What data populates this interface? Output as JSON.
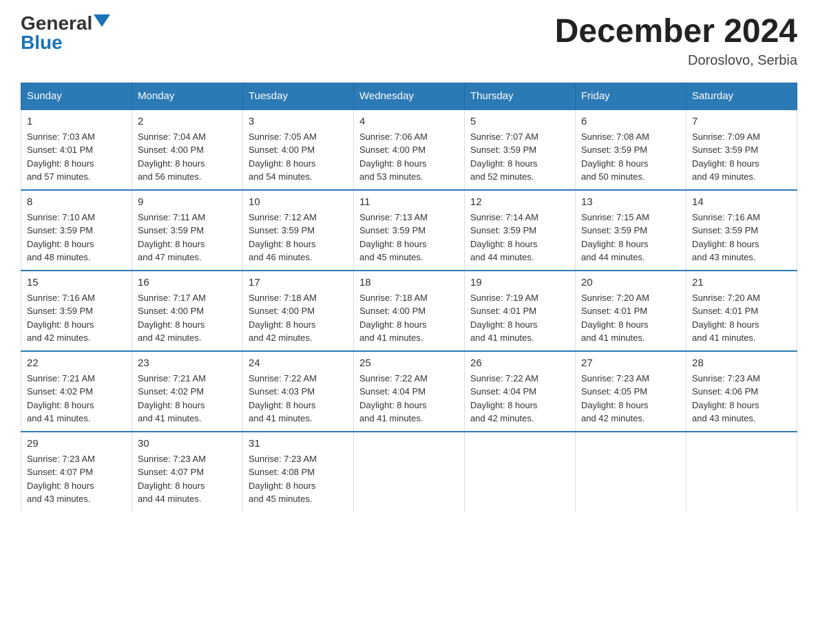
{
  "logo": {
    "general": "General",
    "blue": "Blue"
  },
  "title": "December 2024",
  "location": "Doroslovo, Serbia",
  "days_of_week": [
    "Sunday",
    "Monday",
    "Tuesday",
    "Wednesday",
    "Thursday",
    "Friday",
    "Saturday"
  ],
  "weeks": [
    [
      {
        "day": "1",
        "sunrise": "7:03 AM",
        "sunset": "4:01 PM",
        "daylight": "8 hours and 57 minutes."
      },
      {
        "day": "2",
        "sunrise": "7:04 AM",
        "sunset": "4:00 PM",
        "daylight": "8 hours and 56 minutes."
      },
      {
        "day": "3",
        "sunrise": "7:05 AM",
        "sunset": "4:00 PM",
        "daylight": "8 hours and 54 minutes."
      },
      {
        "day": "4",
        "sunrise": "7:06 AM",
        "sunset": "4:00 PM",
        "daylight": "8 hours and 53 minutes."
      },
      {
        "day": "5",
        "sunrise": "7:07 AM",
        "sunset": "3:59 PM",
        "daylight": "8 hours and 52 minutes."
      },
      {
        "day": "6",
        "sunrise": "7:08 AM",
        "sunset": "3:59 PM",
        "daylight": "8 hours and 50 minutes."
      },
      {
        "day": "7",
        "sunrise": "7:09 AM",
        "sunset": "3:59 PM",
        "daylight": "8 hours and 49 minutes."
      }
    ],
    [
      {
        "day": "8",
        "sunrise": "7:10 AM",
        "sunset": "3:59 PM",
        "daylight": "8 hours and 48 minutes."
      },
      {
        "day": "9",
        "sunrise": "7:11 AM",
        "sunset": "3:59 PM",
        "daylight": "8 hours and 47 minutes."
      },
      {
        "day": "10",
        "sunrise": "7:12 AM",
        "sunset": "3:59 PM",
        "daylight": "8 hours and 46 minutes."
      },
      {
        "day": "11",
        "sunrise": "7:13 AM",
        "sunset": "3:59 PM",
        "daylight": "8 hours and 45 minutes."
      },
      {
        "day": "12",
        "sunrise": "7:14 AM",
        "sunset": "3:59 PM",
        "daylight": "8 hours and 44 minutes."
      },
      {
        "day": "13",
        "sunrise": "7:15 AM",
        "sunset": "3:59 PM",
        "daylight": "8 hours and 44 minutes."
      },
      {
        "day": "14",
        "sunrise": "7:16 AM",
        "sunset": "3:59 PM",
        "daylight": "8 hours and 43 minutes."
      }
    ],
    [
      {
        "day": "15",
        "sunrise": "7:16 AM",
        "sunset": "3:59 PM",
        "daylight": "8 hours and 42 minutes."
      },
      {
        "day": "16",
        "sunrise": "7:17 AM",
        "sunset": "4:00 PM",
        "daylight": "8 hours and 42 minutes."
      },
      {
        "day": "17",
        "sunrise": "7:18 AM",
        "sunset": "4:00 PM",
        "daylight": "8 hours and 42 minutes."
      },
      {
        "day": "18",
        "sunrise": "7:18 AM",
        "sunset": "4:00 PM",
        "daylight": "8 hours and 41 minutes."
      },
      {
        "day": "19",
        "sunrise": "7:19 AM",
        "sunset": "4:01 PM",
        "daylight": "8 hours and 41 minutes."
      },
      {
        "day": "20",
        "sunrise": "7:20 AM",
        "sunset": "4:01 PM",
        "daylight": "8 hours and 41 minutes."
      },
      {
        "day": "21",
        "sunrise": "7:20 AM",
        "sunset": "4:01 PM",
        "daylight": "8 hours and 41 minutes."
      }
    ],
    [
      {
        "day": "22",
        "sunrise": "7:21 AM",
        "sunset": "4:02 PM",
        "daylight": "8 hours and 41 minutes."
      },
      {
        "day": "23",
        "sunrise": "7:21 AM",
        "sunset": "4:02 PM",
        "daylight": "8 hours and 41 minutes."
      },
      {
        "day": "24",
        "sunrise": "7:22 AM",
        "sunset": "4:03 PM",
        "daylight": "8 hours and 41 minutes."
      },
      {
        "day": "25",
        "sunrise": "7:22 AM",
        "sunset": "4:04 PM",
        "daylight": "8 hours and 41 minutes."
      },
      {
        "day": "26",
        "sunrise": "7:22 AM",
        "sunset": "4:04 PM",
        "daylight": "8 hours and 42 minutes."
      },
      {
        "day": "27",
        "sunrise": "7:23 AM",
        "sunset": "4:05 PM",
        "daylight": "8 hours and 42 minutes."
      },
      {
        "day": "28",
        "sunrise": "7:23 AM",
        "sunset": "4:06 PM",
        "daylight": "8 hours and 43 minutes."
      }
    ],
    [
      {
        "day": "29",
        "sunrise": "7:23 AM",
        "sunset": "4:07 PM",
        "daylight": "8 hours and 43 minutes."
      },
      {
        "day": "30",
        "sunrise": "7:23 AM",
        "sunset": "4:07 PM",
        "daylight": "8 hours and 44 minutes."
      },
      {
        "day": "31",
        "sunrise": "7:23 AM",
        "sunset": "4:08 PM",
        "daylight": "8 hours and 45 minutes."
      },
      null,
      null,
      null,
      null
    ]
  ],
  "labels": {
    "sunrise": "Sunrise:",
    "sunset": "Sunset:",
    "daylight": "Daylight:"
  }
}
